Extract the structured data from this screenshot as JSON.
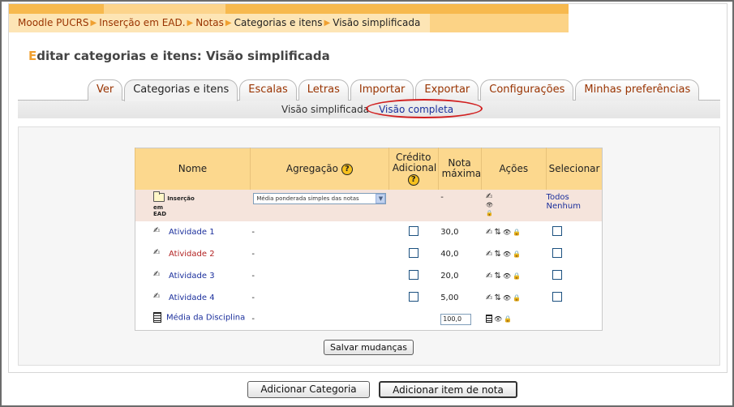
{
  "breadcrumb": [
    {
      "label": "Moodle PUCRS",
      "link": true
    },
    {
      "label": "Inserção em EAD.",
      "link": true
    },
    {
      "label": "Notas",
      "link": true
    },
    {
      "label": "Categorias e itens",
      "link": false
    },
    {
      "label": "Visão simplificada",
      "link": false
    }
  ],
  "page_title": {
    "first_letter": "E",
    "rest": "ditar categorias e itens: Visão simplificada"
  },
  "tabs": [
    "Ver",
    "Categorias e itens",
    "Escalas",
    "Letras",
    "Importar",
    "Exportar",
    "Configurações",
    "Minhas preferências"
  ],
  "active_tab": "Categorias e itens",
  "subtabs": {
    "current": "Visão simplificada",
    "link": "Visão completa"
  },
  "table": {
    "headers": {
      "name": "Nome",
      "aggregation": "Agregação",
      "credit": "Crédito Adicional",
      "max": "Nota máxima",
      "actions": "Ações",
      "select": "Selecionar"
    },
    "category": {
      "name_line1": "Inserção",
      "name_line2": "em",
      "name_line3": "EAD",
      "aggregation_value": "Média ponderada simples das notas",
      "max": "-",
      "select_all": "Todos",
      "select_none": "Nenhum"
    },
    "items": [
      {
        "name": "Atividade 1",
        "aggregation": "-",
        "max": "30,0",
        "color": "#1b2f9c"
      },
      {
        "name": "Atividade 2",
        "aggregation": "-",
        "max": "40,0",
        "color": "#b22222"
      },
      {
        "name": "Atividade 3",
        "aggregation": "-",
        "max": "20,0",
        "color": "#1b2f9c"
      },
      {
        "name": "Atividade 4",
        "aggregation": "-",
        "max": "5,00",
        "color": "#1b2f9c"
      }
    ],
    "total": {
      "name": "Média da Disciplina",
      "aggregation": "-",
      "max_input": "100,0"
    }
  },
  "buttons": {
    "save": "Salvar mudanças",
    "add_category": "Adicionar Categoria",
    "add_item": "Adicionar item de nota"
  },
  "icons": {
    "edit": "✍",
    "move": "⇅",
    "eye": "👁",
    "lock": "🔒"
  }
}
